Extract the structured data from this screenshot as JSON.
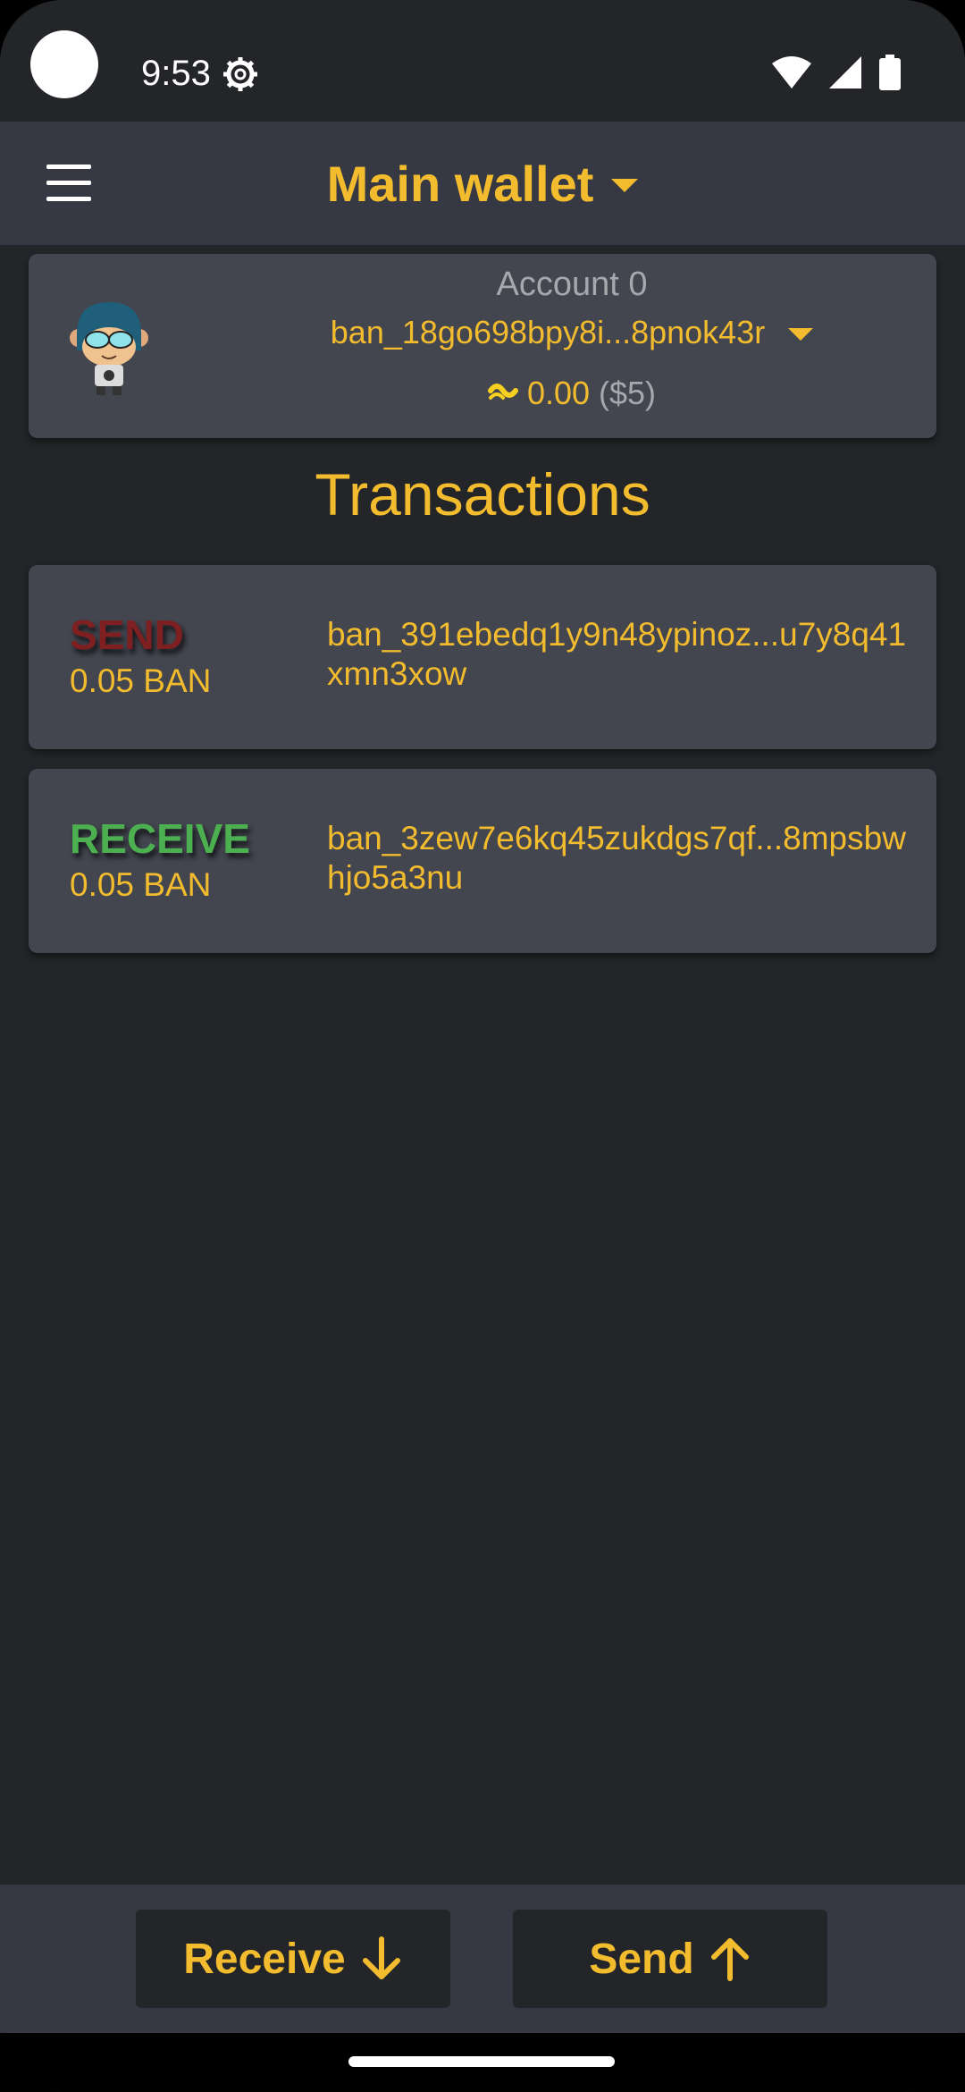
{
  "status_bar": {
    "time": "9:53",
    "icons": [
      "settings-gear-icon",
      "wifi-icon",
      "cellular-signal-icon",
      "battery-icon"
    ]
  },
  "app_bar": {
    "title": "Main wallet",
    "menu_icon": "hamburger-menu-icon",
    "dropdown_icon": "caret-down-icon"
  },
  "account": {
    "name": "Account 0",
    "address": "ban_18go698bpy8i...8pnok43r",
    "balance": "0.00",
    "fiat": "($5)",
    "avatar_icon": "monkey-avatar-icon",
    "currency_icon": "banano-icon"
  },
  "transactions": {
    "title": "Transactions",
    "items": [
      {
        "type": "SEND",
        "amount": "0.05 BAN",
        "address": "ban_391ebedq1y9n48ypinoz...u7y8q41xmn3xow"
      },
      {
        "type": "RECEIVE",
        "amount": "0.05 BAN",
        "address": "ban_3zew7e6kq45zukdgs7qf...8mpsbwhjo5a3nu"
      }
    ]
  },
  "actions": {
    "receive_label": "Receive",
    "send_label": "Send"
  },
  "colors": {
    "accent": "#f2bc2e",
    "background": "#232528",
    "card": "#43454f",
    "bar": "#363943",
    "send": "#7e1f21",
    "receive": "#4caf50"
  }
}
